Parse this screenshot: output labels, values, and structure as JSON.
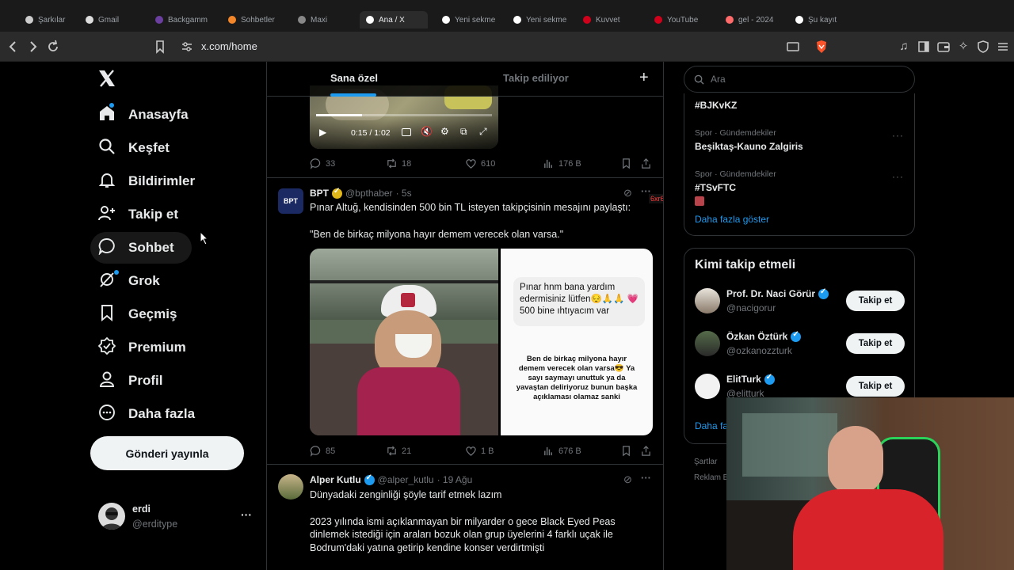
{
  "browser": {
    "tabs": [
      {
        "label": "Şarkılar",
        "color": "#cccccc"
      },
      {
        "label": "Gmail",
        "color": "#dddddd"
      },
      {
        "label": "Backgamm",
        "color": "#6b3fa0"
      },
      {
        "label": "Sohbetler",
        "color": "#f4862a"
      },
      {
        "label": "Maxi",
        "color": "#888888"
      },
      {
        "label": "Ana / X",
        "color": "#ffffff"
      },
      {
        "label": "Yeni sekme",
        "color": "#ffffff"
      },
      {
        "label": "Yeni sekme",
        "color": "#ffffff"
      },
      {
        "label": "Kuvvet",
        "color": "#d0021b"
      },
      {
        "label": "YouTube",
        "color": "#d0021b"
      },
      {
        "label": "gel - 2024",
        "color": "#ff6b6b"
      },
      {
        "label": "Şu kayıt",
        "color": "#ffffff"
      }
    ],
    "url": "x.com/home"
  },
  "nav": {
    "items": [
      {
        "label": "Anasayfa",
        "icon": "home-icon"
      },
      {
        "label": "Keşfet",
        "icon": "search-icon"
      },
      {
        "label": "Bildirimler",
        "icon": "bell-icon"
      },
      {
        "label": "Takip et",
        "icon": "person-plus-icon"
      },
      {
        "label": "Sohbet",
        "icon": "chat-icon"
      },
      {
        "label": "Grok",
        "icon": "grok-icon"
      },
      {
        "label": "Geçmiş",
        "icon": "bookmark-icon"
      },
      {
        "label": "Premium",
        "icon": "verified-icon"
      },
      {
        "label": "Profil",
        "icon": "person-icon"
      },
      {
        "label": "Daha fazla",
        "icon": "more-circle-icon"
      }
    ],
    "post_button": "Gönderi yayınla",
    "account": {
      "name": "erdi",
      "handle": "@erditype",
      "menu": "···"
    }
  },
  "feed": {
    "tabs": [
      "Sana özel",
      "Takip ediliyor"
    ],
    "add_icon": "+",
    "video": {
      "time": "0:15 / 1:02"
    },
    "tweet0_stats": {
      "replies": "33",
      "reposts": "18",
      "likes": "610",
      "views": "176 B"
    },
    "tweet1": {
      "name": "BPT",
      "handle": "@bpthaber",
      "time": "· 5s",
      "avatar_text": "BPT",
      "text1": "Pınar Altuğ, kendisinden 500 bin TL isteyen takipçisinin mesajını paylaştı:",
      "text2": "\"Ben de birkaç milyona hayır demem verecek olan varsa.\"",
      "overlay_text": "6xr6 :",
      "image2_line1": "Pınar hnm bana yardım edermisiniz lütfen😔🙏🙏 💗 500 bine ıhtıyacım var",
      "image2_line2": "Ben de birkaç milyona hayır demem verecek olan varsa😎 Ya sayı saymayı unuttuk ya da yavaştan deliriyoruz bunun başka açıklaması olamaz sanki",
      "stats": {
        "replies": "85",
        "reposts": "21",
        "likes": "1 B",
        "views": "676 B"
      }
    },
    "tweet2": {
      "name": "Alper Kutlu",
      "handle": "@alper_kutlu",
      "time": "· 19 Ağu",
      "text1": "Dünyadaki zenginliği şöyle tarif etmek lazım",
      "text2": "2023 yılında ismi açıklanmayan bir milyarder o gece Black Eyed Peas dinlemek istediği için araları bozuk olan grup üyelerini 4 farklı uçak ile",
      "text3": "Bodrum'daki yatına getirip kendine konser verdirtmişti"
    }
  },
  "sidebar": {
    "search_placeholder": "Ara",
    "trends": [
      {
        "meta": "",
        "name": "#BJKvKZ"
      },
      {
        "meta": "Spor · Gündemdekiler",
        "name": "Beşiktaş-Kauno Zalgiris"
      },
      {
        "meta": "Spor · Gündemdekiler",
        "name": "#TSvFTC"
      }
    ],
    "show_more": "Daha fazla göster",
    "who_to_follow": {
      "title": "Kimi takip etmeli",
      "users": [
        {
          "name": "Prof. Dr. Naci Görür",
          "handle": "@nacigorur",
          "button": "Takip et"
        },
        {
          "name": "Özkan Öztürk",
          "handle": "@ozkanozzturk",
          "button": "Takip et"
        },
        {
          "name": "ElitTurk",
          "handle": "@elitturk",
          "button": "Takip et"
        }
      ],
      "show_more": "Daha fa"
    },
    "footer": [
      "Şartlar",
      "Reklam Bi"
    ]
  },
  "colors": {
    "accent": "#1d9bf0",
    "background": "#000000",
    "border": "#2f3336",
    "gold_verified": "#e2b719"
  }
}
